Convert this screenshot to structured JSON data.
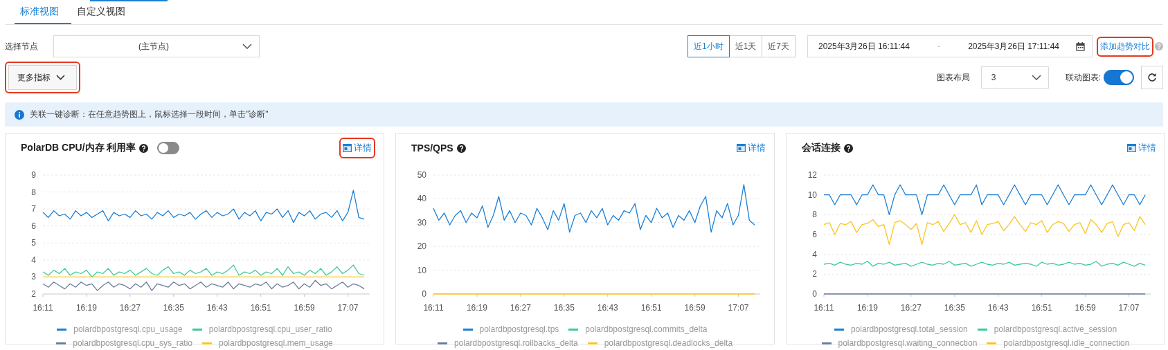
{
  "tabs": [
    {
      "label": "标准视图",
      "selected": true
    },
    {
      "label": "自定义视图",
      "selected": false
    }
  ],
  "node_select": {
    "label": "选择节点",
    "value": "(主节点)"
  },
  "time_ranges": [
    {
      "label": "近1小时",
      "selected": true
    },
    {
      "label": "近1天",
      "selected": false
    },
    {
      "label": "近7天",
      "selected": false
    }
  ],
  "date_range": {
    "start": "2025年3月26日 16:11:44",
    "separator": "-",
    "end": "2025年3月26日 17:11:44"
  },
  "compare_link": {
    "label": "添加趋势对比",
    "highlighted": true
  },
  "more_metrics": {
    "label": "更多指标",
    "highlighted": true
  },
  "layout_select": {
    "label": "图表布局",
    "value": "3"
  },
  "linked_charts": {
    "label": "联动图表:",
    "on": true
  },
  "notice": "关联一键诊断：在任意趋势图上，鼠标选择一段时间，单击\"诊断\"",
  "charts": [
    {
      "title": "PolarDB CPU/内存 利用率",
      "toggle": {
        "on": false
      },
      "detail": {
        "label": "详情",
        "highlighted": true
      },
      "chart_data": {
        "type": "line",
        "grid": true,
        "ylim": [
          2,
          9
        ],
        "yticks": [
          2,
          3,
          4,
          5,
          6,
          7,
          8,
          9
        ],
        "categories": [
          "16:11",
          null,
          null,
          null,
          null,
          null,
          null,
          null,
          "16:19",
          null,
          null,
          null,
          null,
          null,
          null,
          null,
          "16:27",
          null,
          null,
          null,
          null,
          null,
          null,
          null,
          "16:35",
          null,
          null,
          null,
          null,
          null,
          null,
          null,
          "16:43",
          null,
          null,
          null,
          null,
          null,
          null,
          null,
          "16:51",
          null,
          null,
          null,
          null,
          null,
          null,
          null,
          "16:59",
          null,
          null,
          null,
          null,
          null,
          null,
          null,
          "17:07",
          null,
          null,
          null
        ],
        "series": [
          {
            "name": "polardbpostgresql.cpu_usage",
            "color": "#1a7fd6",
            "values": [
              6.8,
              6.5,
              6.9,
              6.6,
              6.7,
              6.4,
              6.9,
              6.6,
              6.8,
              6.5,
              6.7,
              6.9,
              6.3,
              6.8,
              6.6,
              6.7,
              6.5,
              6.9,
              6.6,
              6.7,
              6.4,
              6.8,
              6.6,
              6.9,
              6.5,
              6.7,
              6.6,
              6.8,
              6.4,
              6.7,
              6.9,
              6.5,
              6.8,
              6.6,
              6.7,
              7.0,
              6.4,
              6.8,
              6.6,
              6.9,
              6.3,
              6.8,
              6.7,
              7.0,
              6.5,
              6.9,
              6.2,
              6.8,
              6.6,
              6.9,
              6.4,
              6.7,
              6.8,
              6.5,
              6.9,
              6.3,
              6.8,
              8.1,
              6.5,
              6.4
            ]
          },
          {
            "name": "polardbpostgresql.cpu_user_ratio",
            "color": "#3ccb96",
            "values": [
              3.3,
              3.1,
              3.4,
              3.2,
              3.5,
              3.1,
              3.3,
              3.2,
              3.4,
              3.0,
              3.3,
              3.2,
              3.5,
              3.1,
              3.3,
              3.2,
              3.4,
              3.1,
              3.3,
              3.5,
              3.2,
              3.1,
              3.4,
              3.6,
              3.2,
              3.3,
              3.1,
              3.4,
              3.2,
              3.3,
              3.5,
              3.1,
              3.3,
              3.2,
              3.4,
              3.7,
              3.1,
              3.3,
              3.2,
              3.4,
              3.1,
              3.3,
              3.2,
              3.5,
              3.1,
              3.6,
              3.2,
              3.3,
              3.1,
              3.4,
              3.2,
              3.5,
              3.1,
              3.3,
              3.6,
              3.2,
              3.4,
              3.7,
              3.2,
              3.1
            ]
          },
          {
            "name": "polardbpostgresql.cpu_sys_ratio",
            "color": "#6a7b9d",
            "values": [
              2.6,
              2.4,
              2.7,
              2.5,
              2.3,
              2.6,
              2.4,
              2.7,
              2.5,
              2.6,
              2.2,
              2.5,
              2.7,
              2.4,
              2.6,
              2.5,
              2.3,
              2.6,
              2.4,
              2.7,
              2.2,
              2.6,
              2.5,
              2.4,
              2.7,
              2.5,
              2.6,
              2.3,
              2.5,
              2.7,
              2.4,
              2.6,
              2.5,
              2.4,
              2.7,
              2.3,
              2.6,
              2.5,
              2.4,
              2.6,
              2.5,
              2.7,
              2.3,
              2.6,
              2.4,
              2.5,
              2.7,
              2.3,
              2.6,
              2.4,
              2.8,
              2.5,
              2.6,
              2.3,
              2.5,
              2.7,
              2.4,
              2.6,
              2.5,
              2.3
            ]
          },
          {
            "name": "polardbpostgresql.mem_usage",
            "color": "#fcc41c",
            "values": [
              3,
              3,
              3,
              3,
              3,
              3,
              3,
              3,
              3,
              3,
              3,
              3,
              3,
              3,
              3,
              3,
              3,
              3,
              3,
              3,
              3,
              3,
              3,
              3,
              3,
              3,
              3,
              3,
              3,
              3,
              3,
              3,
              3,
              3,
              3,
              3,
              3,
              3,
              3,
              3,
              3,
              3,
              3,
              3,
              3,
              3,
              3,
              3,
              3,
              3,
              3,
              3,
              3,
              3,
              3,
              3,
              3,
              3,
              3,
              3
            ]
          }
        ]
      }
    },
    {
      "title": "TPS/QPS",
      "detail": {
        "label": "详情",
        "highlighted": false
      },
      "chart_data": {
        "type": "line",
        "grid": true,
        "ylim": [
          0,
          50
        ],
        "yticks": [
          0,
          10,
          20,
          30,
          40,
          50
        ],
        "categories": [
          "16:11",
          null,
          null,
          null,
          null,
          null,
          null,
          null,
          "16:19",
          null,
          null,
          null,
          null,
          null,
          null,
          null,
          "16:27",
          null,
          null,
          null,
          null,
          null,
          null,
          null,
          "16:35",
          null,
          null,
          null,
          null,
          null,
          null,
          null,
          "16:43",
          null,
          null,
          null,
          null,
          null,
          null,
          null,
          "16:51",
          null,
          null,
          null,
          null,
          null,
          null,
          null,
          "16:59",
          null,
          null,
          null,
          null,
          null,
          null,
          null,
          "17:07",
          null,
          null,
          null
        ],
        "series": [
          {
            "name": "polardbpostgresql.tps",
            "color": "#1a7fd6",
            "values": [
              36,
              31,
              34,
              29,
              33,
              35,
              30,
              34,
              32,
              37,
              28,
              33,
              41,
              31,
              35,
              30,
              34,
              33,
              29,
              36,
              32,
              27,
              35,
              31,
              38,
              26,
              33,
              34,
              30,
              35,
              32,
              36,
              29,
              33,
              31,
              35,
              34,
              38,
              27,
              33,
              30,
              36,
              32,
              34,
              28,
              33,
              31,
              35,
              30,
              37,
              41,
              26,
              35,
              32,
              38,
              29,
              33,
              46,
              31,
              29
            ]
          },
          {
            "name": "polardbpostgresql.commits_delta",
            "color": "#3ccb96",
            "values": [
              null,
              null,
              null,
              null,
              null,
              null,
              null,
              null,
              null,
              null,
              null,
              null,
              null,
              null,
              null,
              null,
              null,
              null,
              null,
              null,
              null,
              null,
              null,
              null,
              null,
              null,
              null,
              null,
              null,
              null,
              null,
              null,
              null,
              null,
              null,
              null,
              null,
              null,
              null,
              null,
              null,
              null,
              null,
              null,
              null,
              null,
              null,
              null,
              null,
              null,
              null,
              null,
              null,
              null,
              null,
              null,
              null,
              null,
              null,
              null
            ]
          },
          {
            "name": "polardbpostgresql.rollbacks_delta",
            "color": "#6a7b9d",
            "values": [
              null,
              null,
              null,
              null,
              null,
              null,
              null,
              null,
              null,
              null,
              null,
              null,
              null,
              null,
              null,
              null,
              null,
              null,
              null,
              null,
              null,
              null,
              null,
              null,
              null,
              null,
              null,
              null,
              null,
              null,
              null,
              null,
              null,
              null,
              null,
              null,
              null,
              null,
              null,
              null,
              null,
              null,
              null,
              null,
              null,
              null,
              null,
              null,
              null,
              null,
              null,
              null,
              null,
              null,
              null,
              null,
              null,
              null,
              null,
              null
            ]
          },
          {
            "name": "polardbpostgresql.deadlocks_delta",
            "color": "#fcc41c",
            "values": [
              0,
              0,
              0,
              0,
              0,
              0,
              0,
              0,
              0,
              0,
              0,
              0,
              0,
              0,
              0,
              0,
              0,
              0,
              0,
              0,
              0,
              0,
              0,
              0,
              0,
              0,
              0,
              0,
              0,
              0,
              0,
              0,
              0,
              0,
              0,
              0,
              0,
              0,
              0,
              0,
              0,
              0,
              0,
              0,
              0,
              0,
              0,
              0,
              0,
              0,
              0,
              0,
              0,
              0,
              0,
              0,
              0,
              0,
              0,
              0
            ]
          }
        ]
      }
    },
    {
      "title": "会话连接",
      "detail": {
        "label": "详情",
        "highlighted": false
      },
      "chart_data": {
        "type": "line",
        "grid": true,
        "ylim": [
          0,
          12
        ],
        "yticks": [
          0,
          2,
          4,
          6,
          8,
          10,
          12
        ],
        "categories": [
          "16:11",
          null,
          null,
          null,
          null,
          null,
          null,
          null,
          "16:19",
          null,
          null,
          null,
          null,
          null,
          null,
          null,
          "16:27",
          null,
          null,
          null,
          null,
          null,
          null,
          null,
          "16:35",
          null,
          null,
          null,
          null,
          null,
          null,
          null,
          "16:43",
          null,
          null,
          null,
          null,
          null,
          null,
          null,
          "16:51",
          null,
          null,
          null,
          null,
          null,
          null,
          null,
          "16:59",
          null,
          null,
          null,
          null,
          null,
          null,
          null,
          "17:07",
          null,
          null,
          null
        ],
        "series": [
          {
            "name": "polardbpostgresql.total_session",
            "color": "#1a7fd6",
            "values": [
              10,
              10,
              9,
              10,
              10,
              10,
              9,
              10,
              10,
              11,
              10,
              10,
              8,
              10,
              11,
              10,
              10,
              10,
              8,
              10,
              10,
              10,
              11,
              10,
              9,
              10,
              10,
              10,
              11,
              9,
              10,
              10,
              10,
              9,
              10,
              11,
              10,
              9,
              10,
              10,
              10,
              9,
              10,
              11,
              10,
              9,
              10,
              10,
              10,
              11,
              10,
              9,
              10,
              11,
              10,
              9,
              10,
              10,
              9,
              10
            ]
          },
          {
            "name": "polardbpostgresql.active_session",
            "color": "#3ccb96",
            "values": [
              3,
              3.1,
              2.9,
              3.2,
              3,
              2.9,
              3.1,
              3,
              3.3,
              2.8,
              3.1,
              3,
              3.2,
              2.9,
              3,
              3.1,
              2.8,
              3,
              3.2,
              3,
              2.9,
              3.1,
              3,
              3.3,
              2.9,
              3,
              3.1,
              2.8,
              3,
              3.2,
              3,
              2.9,
              3.1,
              3,
              3.2,
              2.9,
              3,
              3.1,
              3,
              2.8,
              3.2,
              3,
              3.1,
              2.9,
              3,
              3.2,
              3,
              3.1,
              2.9,
              3,
              3.3,
              2.8,
              3,
              3.1,
              2.9,
              3.2,
              3,
              2.8,
              3.1,
              2.9
            ]
          },
          {
            "name": "polardbpostgresql.waiting_connection",
            "color": "#6a7b9d",
            "values": [
              0,
              0,
              0,
              0,
              0,
              0,
              0,
              0,
              0,
              0,
              0,
              0,
              0,
              0,
              0,
              0,
              0,
              0,
              0,
              0,
              0,
              0,
              0,
              0,
              0,
              0,
              0,
              0,
              0,
              0,
              0,
              0,
              0,
              0,
              0,
              0,
              0,
              0,
              0,
              0,
              0,
              0,
              0,
              0,
              0,
              0,
              0,
              0,
              0,
              0,
              0,
              0,
              0,
              0,
              0,
              0,
              0,
              0,
              0,
              0
            ]
          },
          {
            "name": "polardbpostgresql.idle_connection",
            "color": "#fcc41c",
            "values": [
              7,
              7.2,
              6,
              7.1,
              7,
              7.3,
              6.2,
              7,
              7.1,
              7.5,
              6.8,
              7,
              5,
              7.2,
              7.4,
              7,
              6.5,
              7.1,
              5,
              7.2,
              7,
              7.3,
              6.3,
              7.1,
              8,
              7,
              7.2,
              6.2,
              7.4,
              6,
              7,
              7.1,
              7.3,
              6.4,
              7,
              7.8,
              7,
              6.3,
              7.2,
              7,
              7.4,
              6.2,
              7,
              7.3,
              7.1,
              6.3,
              7,
              7.2,
              6.1,
              7.5,
              7,
              6.2,
              7.1,
              7.3,
              5.8,
              7,
              7.2,
              6.4,
              7.8,
              7
            ]
          }
        ]
      }
    }
  ]
}
